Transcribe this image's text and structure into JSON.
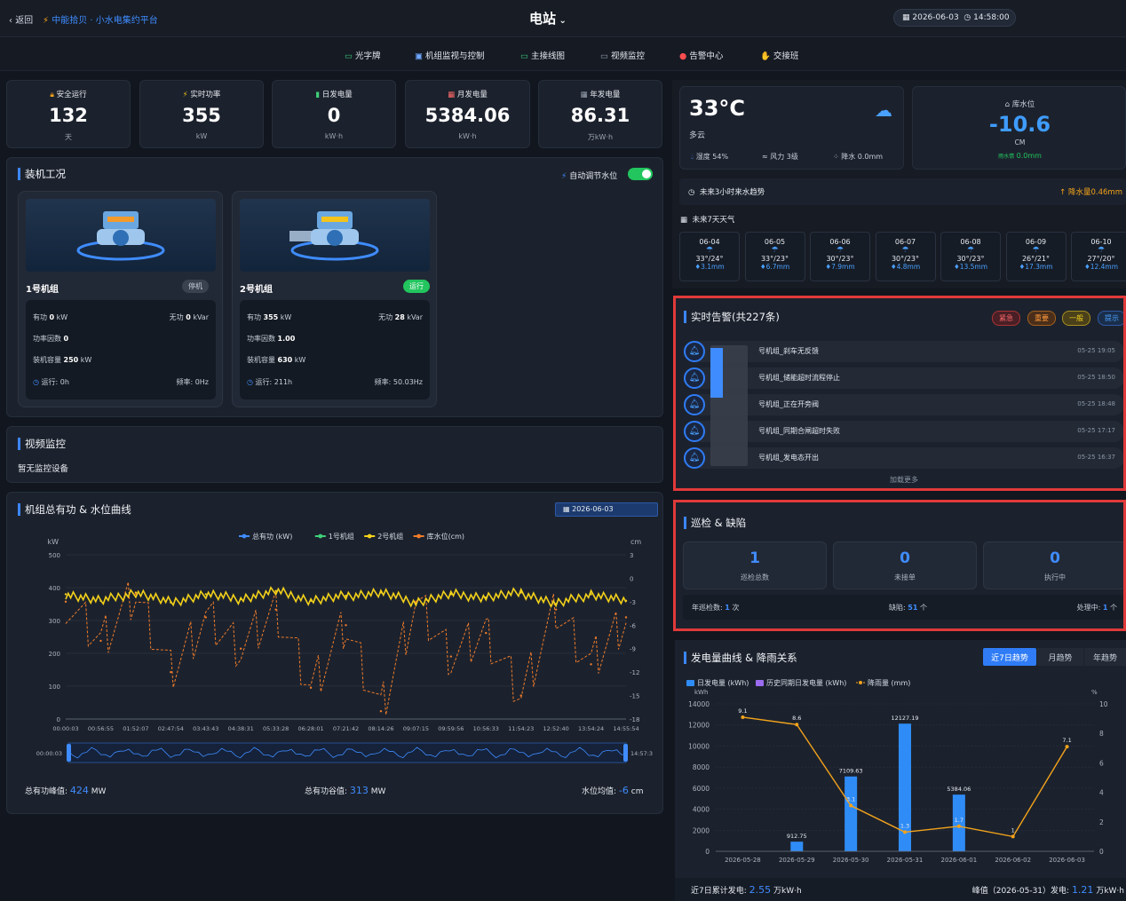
{
  "header": {
    "back": "返回",
    "brand": "中能拾贝 · 小水电集约平台",
    "station": "电站",
    "date": "2026-06-03",
    "time": "14:58:00"
  },
  "nav": [
    {
      "label": "光字牌",
      "icon": "monitor-icon"
    },
    {
      "label": "机组监视与控制",
      "icon": "control-icon"
    },
    {
      "label": "主接线图",
      "icon": "diagram-icon"
    },
    {
      "label": "视频监控",
      "icon": "camera-icon"
    },
    {
      "label": "告警中心",
      "icon": "alert-icon"
    },
    {
      "label": "交接班",
      "icon": "handover-icon"
    }
  ],
  "kpis": [
    {
      "label": "安全运行",
      "value": "132",
      "unit": "天",
      "icon": "lock-icon"
    },
    {
      "label": "实时功率",
      "value": "355",
      "unit": "kW",
      "icon": "bolt-icon"
    },
    {
      "label": "日发电量",
      "value": "0",
      "unit": "kW·h",
      "icon": "bar-icon"
    },
    {
      "label": "月发电量",
      "value": "5384.06",
      "unit": "kW·h",
      "icon": "calendar-icon"
    },
    {
      "label": "年发电量",
      "value": "86.31",
      "unit": "万kW·h",
      "icon": "calendar-icon"
    }
  ],
  "machines": {
    "title": "装机工况",
    "auto_label": "自动调节水位",
    "units": [
      {
        "name": "1号机组",
        "status": "停机",
        "active_label": "有功",
        "active": "0",
        "active_unit": "kW",
        "reactive_label": "无功",
        "reactive": "0",
        "reactive_unit": "kVar",
        "pf_label": "功率因数",
        "pf": "0",
        "cap_label": "装机容量",
        "cap": "250",
        "cap_unit": "kW",
        "run": "运行: 0h",
        "freq": "频率: 0Hz"
      },
      {
        "name": "2号机组",
        "status": "运行",
        "active_label": "有功",
        "active": "355",
        "active_unit": "kW",
        "reactive_label": "无功",
        "reactive": "28",
        "reactive_unit": "kVar",
        "pf_label": "功率因数",
        "pf": "1.00",
        "cap_label": "装机容量",
        "cap": "630",
        "cap_unit": "kW",
        "run": "运行: 211h",
        "freq": "频率: 50.03Hz"
      }
    ]
  },
  "video": {
    "title": "视频监控",
    "empty": "暂无监控设备"
  },
  "curve": {
    "title": "机组总有功 & 水位曲线",
    "date": "2026-06-03",
    "legend": [
      "总有功 (kW)",
      "1号机组",
      "2号机组",
      "库水位(cm)"
    ],
    "ylabel_left": "kW",
    "ylabel_right": "cm",
    "range_start": "00:00:03",
    "range_end": "14:57:3",
    "footer": {
      "peak_label": "总有功峰值:",
      "peak": "424",
      "peak_unit": "MW",
      "valley_label": "总有功谷值:",
      "valley": "313",
      "valley_unit": "MW",
      "level_label": "水位均值:",
      "level": "-6",
      "level_unit": "cm"
    }
  },
  "weather": {
    "temp": "33°C",
    "desc": "多云",
    "humidity": "湿度 54%",
    "wind": "风力 3级",
    "rain": "降水 0.0mm",
    "level_label": "库水位",
    "level_value": "-10.6",
    "level_unit": "CM",
    "rain_label": "雨水情",
    "rain_value": "0.0mm",
    "trend_label": "未来3小时来水趋势",
    "trend_value": "降水量0.46mm",
    "forecast_title": "未来7天天气",
    "days": [
      {
        "date": "06-04",
        "temp": "33°/24°",
        "rain": "3.1mm"
      },
      {
        "date": "06-05",
        "temp": "33°/23°",
        "rain": "6.7mm"
      },
      {
        "date": "06-06",
        "temp": "30°/23°",
        "rain": "7.9mm"
      },
      {
        "date": "06-07",
        "temp": "30°/23°",
        "rain": "4.8mm"
      },
      {
        "date": "06-08",
        "temp": "30°/23°",
        "rain": "13.5mm"
      },
      {
        "date": "06-09",
        "temp": "26°/21°",
        "rain": "17.3mm"
      },
      {
        "date": "06-10",
        "temp": "27°/20°",
        "rain": "12.4mm"
      }
    ]
  },
  "alarms": {
    "title": "实时告警(共227条)",
    "filters": [
      "紧急",
      "重要",
      "一般",
      "提示"
    ],
    "more": "加载更多",
    "items": [
      {
        "text": "号机组_刹车无反馈",
        "time": "05-25 19:05"
      },
      {
        "text": "号机组_储能超时流程停止",
        "time": "05-25 18:50"
      },
      {
        "text": "号机组_正在开旁阀",
        "time": "05-25 18:48"
      },
      {
        "text": "号机组_同期合闸超时失败",
        "time": "05-25 17:17"
      },
      {
        "text": "号机组_发电态开出",
        "time": "05-25 16:37"
      }
    ]
  },
  "patrol": {
    "title": "巡检 & 缺陷",
    "boxes": [
      {
        "value": "1",
        "label": "巡检总数"
      },
      {
        "value": "0",
        "label": "未接单"
      },
      {
        "value": "0",
        "label": "执行中"
      }
    ],
    "footer": {
      "year_label": "年巡检数:",
      "year_value": "1",
      "year_unit": "次",
      "defect_label": "缺陷:",
      "defect_value": "51",
      "defect_unit": "个",
      "handling_label": "处理中:",
      "handling_value": "1",
      "handling_unit": "个"
    }
  },
  "gen": {
    "title": "发电量曲线 & 降雨关系",
    "tabs": [
      "近7日趋势",
      "月趋势",
      "年趋势"
    ],
    "footer": {
      "sum_label": "近7日累计发电:",
      "sum_value": "2.55",
      "sum_unit": "万kW·h",
      "peak_label": "峰值（2026-05-31）发电:",
      "peak_value": "1.21",
      "peak_unit": "万kW·h"
    }
  },
  "chart_data": [
    {
      "type": "line",
      "title": "机组总有功 & 水位曲线",
      "xlabel": "",
      "ylabel": "kW",
      "y2label": "cm",
      "ylim": [
        0,
        500
      ],
      "y2lim": [
        -18,
        3
      ],
      "x": [
        "00:00:03",
        "00:56:55",
        "01:52:07",
        "02:47:54",
        "03:43:43",
        "04:38:31",
        "05:33:28",
        "06:28:01",
        "07:21:42",
        "08:14:26",
        "09:07:15",
        "09:59:56",
        "10:56:33",
        "11:54:23",
        "12:52:40",
        "13:54:24",
        "14:55:54"
      ],
      "series": [
        {
          "name": "2号机组",
          "values": [
            380,
            360,
            385,
            355,
            380,
            365,
            390,
            360,
            375,
            385,
            355,
            380,
            370,
            385,
            350,
            380,
            360
          ]
        },
        {
          "name": "库水位(cm)",
          "values": [
            -3,
            -8,
            -2,
            -12,
            -5,
            -9,
            -4,
            -14,
            -6,
            -17,
            -3,
            -10,
            -7,
            -15,
            -4,
            -11,
            -5
          ]
        }
      ]
    },
    {
      "type": "bar",
      "title": "发电量曲线 & 降雨关系",
      "xlabel": "",
      "ylabel": "kWh",
      "y2label": "%",
      "ylim": [
        0,
        14000
      ],
      "y2lim": [
        0,
        10
      ],
      "categories": [
        "2026-05-28",
        "2026-05-29",
        "2026-05-30",
        "2026-05-31",
        "2026-06-01",
        "2026-06-02",
        "2026-06-03"
      ],
      "series": [
        {
          "name": "日发电量 (kWh)",
          "values": [
            0,
            912.75,
            7109.63,
            12127.19,
            5384.06,
            0,
            0
          ]
        },
        {
          "name": "降雨量 (mm)",
          "type": "line",
          "values": [
            9.1,
            8.6,
            3.1,
            1.3,
            1.7,
            1,
            7.1
          ]
        }
      ],
      "legend": [
        "日发电量 (kWh)",
        "历史同期日发电量 (kWh)",
        "降雨量 (mm)"
      ]
    }
  ]
}
